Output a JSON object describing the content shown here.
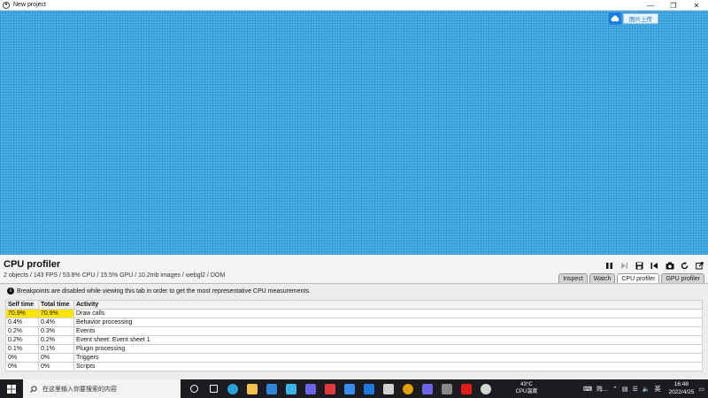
{
  "window": {
    "title": "New project",
    "controls": [
      "minimize",
      "maximize",
      "close"
    ]
  },
  "canvas": {
    "upload_button": "图片上传"
  },
  "profiler": {
    "title": "CPU profiler",
    "stats": "2 objects / 143 FPS / 53.8% CPU / 15.5% GPU / 10.2mb images / webgl2 / DOM",
    "toolbar": [
      "pause-icon",
      "step-icon",
      "save-icon",
      "restart-icon",
      "camera-icon",
      "reload-icon",
      "popout-icon"
    ],
    "tabs": [
      {
        "label": "Inspect",
        "active": false
      },
      {
        "label": "Watch",
        "active": false
      },
      {
        "label": "CPU profiler",
        "active": true
      },
      {
        "label": "GPU profiler",
        "active": false
      }
    ],
    "notice": "Breakpoints are disabled while viewing this tab in order to get the most representative CPU measurements.",
    "table": {
      "headers": [
        "Self time",
        "Total time",
        "Activity"
      ],
      "rows": [
        [
          "70.9%",
          "70.9%",
          "Draw calls"
        ],
        [
          "0.4%",
          "0.4%",
          "Behavior processing"
        ],
        [
          "0.2%",
          "0.3%",
          "Events"
        ],
        [
          "0.2%",
          "0.2%",
          "Event sheet: Event sheet 1"
        ],
        [
          "0.1%",
          "0.1%",
          "Plugin processing"
        ],
        [
          "0%",
          "0%",
          "Triggers"
        ],
        [
          "0%",
          "0%",
          "Scripts"
        ]
      ],
      "highlight_color": "#ffe500"
    }
  },
  "taskbar": {
    "search_placeholder": "在这里输入你要搜索的内容",
    "weather_temp": "43°C",
    "weather_label": "CPU温度",
    "tray_text": "阵...",
    "ime": "英",
    "time": "16:48",
    "date": "2022/4/25",
    "app_icons": [
      {
        "name": "task-view-icon",
        "color": "#ffffff"
      },
      {
        "name": "widgets-icon",
        "color": "#ffffff"
      },
      {
        "name": "edge-icon",
        "color": "#2aa0d8"
      },
      {
        "name": "file-explorer-icon",
        "color": "#f2c14e"
      },
      {
        "name": "mail-icon",
        "color": "#2f86d6"
      },
      {
        "name": "app-triangle-icon",
        "color": "#3bb3e8"
      },
      {
        "name": "app-g-icon",
        "color": "#6c63e6"
      },
      {
        "name": "wps-icon",
        "color": "#e23b3b"
      },
      {
        "name": "feishu-icon",
        "color": "#3a8ef0"
      },
      {
        "name": "cloud-app-icon",
        "color": "#1e7be0"
      },
      {
        "name": "printer-icon",
        "color": "#d0d0d0"
      },
      {
        "name": "chrome-icon",
        "color": "#e0a000"
      },
      {
        "name": "app-g2-icon",
        "color": "#6c63e6"
      },
      {
        "name": "app-grey-icon",
        "color": "#888888"
      },
      {
        "name": "app-red-icon",
        "color": "#e21b1b"
      },
      {
        "name": "app-ball-icon",
        "color": "#cfd8d0"
      }
    ]
  }
}
